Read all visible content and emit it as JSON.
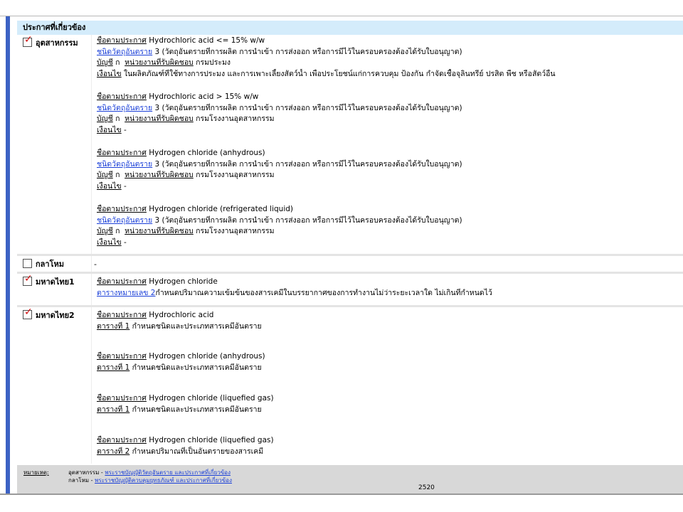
{
  "section": {
    "title": "ประกาศที่เกี่ยวข้อง"
  },
  "categories": [
    {
      "label": "อุตสาหกรรม",
      "checked": true,
      "entries": [
        {
          "name_label": "ชื่อตามประกาศ",
          "name": "Hydrochloric acid <= 15% w/w",
          "type_label": "ชนิดวัตถุอันตราย",
          "type_text": "3 (วัตถุอันตรายที่การผลิต การนำเข้า การส่งออก หรือการมีไว้ในครอบครองต้องได้รับใบอนุญาต)",
          "list_label": "บัญชี",
          "list_value": "ก",
          "agency_label": "หน่วยงานที่รับผิดชอบ",
          "agency_value": "กรมประมง",
          "cond_label": "เงื่อนไข",
          "cond_text": "ในผลิตภัณฑ์ที่ใช้ทางการประมง และการเพาะเลี้ยงสัตว์น้ำ เพื่อประโยชน์แก่การควบคุม ป้องกัน กำจัดเชื้อจุลินทรีย์ ปรสิต พืช หรือสัตว์อื่น"
        },
        {
          "name_label": "ชื่อตามประกาศ",
          "name": "Hydrochloric acid > 15% w/w",
          "type_label": "ชนิดวัตถุอันตราย",
          "type_text": "3 (วัตถุอันตรายที่การผลิต การนำเข้า การส่งออก หรือการมีไว้ในครอบครองต้องได้รับใบอนุญาต)",
          "list_label": "บัญชี",
          "list_value": "ก",
          "agency_label": "หน่วยงานที่รับผิดชอบ",
          "agency_value": "กรมโรงงานอุตสาหกรรม",
          "cond_label": "เงื่อนไข",
          "cond_text": "-"
        },
        {
          "name_label": "ชื่อตามประกาศ",
          "name": "Hydrogen chloride (anhydrous)",
          "type_label": "ชนิดวัตถุอันตราย",
          "type_text": "3 (วัตถุอันตรายที่การผลิต การนำเข้า การส่งออก หรือการมีไว้ในครอบครองต้องได้รับใบอนุญาต)",
          "list_label": "บัญชี",
          "list_value": "ก",
          "agency_label": "หน่วยงานที่รับผิดชอบ",
          "agency_value": "กรมโรงงานอุตสาหกรรม",
          "cond_label": "เงื่อนไข",
          "cond_text": "-"
        },
        {
          "name_label": "ชื่อตามประกาศ",
          "name": "Hydrogen chloride (refrigerated liquid)",
          "type_label": "ชนิดวัตถุอันตราย",
          "type_text": "3 (วัตถุอันตรายที่การผลิต การนำเข้า การส่งออก หรือการมีไว้ในครอบครองต้องได้รับใบอนุญาต)",
          "list_label": "บัญชี",
          "list_value": "ก",
          "agency_label": "หน่วยงานที่รับผิดชอบ",
          "agency_value": "กรมโรงงานอุตสาหกรรม",
          "cond_label": "เงื่อนไข",
          "cond_text": "-"
        }
      ]
    },
    {
      "label": "กลาโหม",
      "checked": false,
      "empty_text": "-"
    },
    {
      "label": "มหาดไทย1",
      "checked": true,
      "entries": [
        {
          "name_label": "ชื่อตามประกาศ",
          "name": "Hydrogen chloride",
          "table_label": "ตารางหมายเลข 2",
          "table_text": "กำหนดปริมาณความเข้มข้นของสารเคมีในบรรยากาศของการทำงานไม่ว่าระยะเวลาใด ไม่เกินที่กำหนดไว้"
        }
      ]
    },
    {
      "label": "มหาดไทย2",
      "checked": true,
      "entries": [
        {
          "name_label": "ชื่อตามประกาศ",
          "name": "Hydrochloric acid",
          "table_label": "ตารางที่ 1",
          "table_text": "กำหนดชนิดและประเภทสารเคมีอันตราย"
        },
        {
          "name_label": "ชื่อตามประกาศ",
          "name": "Hydrogen chloride (anhydrous)",
          "table_label": "ตารางที่ 1",
          "table_text": "กำหนดชนิดและประเภทสารเคมีอันตราย"
        },
        {
          "name_label": "ชื่อตามประกาศ",
          "name": "Hydrogen chloride (liquefied gas)",
          "table_label": "ตารางที่ 1",
          "table_text": "กำหนดชนิดและประเภทสารเคมีอันตราย"
        },
        {
          "name_label": "ชื่อตามประกาศ",
          "name": "Hydrogen chloride (liquefied gas)",
          "table_label": "ตารางที่ 2",
          "table_text": "กำหนดปริมาณที่เป็นอันตรายของสารเคมี"
        }
      ]
    }
  ],
  "notes": {
    "heading": "หมายเหตุ:",
    "line1_prefix": "อุตสาหกรรม -",
    "line1_link": "พระราชบัญญัติวัตถุอันตราย และประกาศที่เกี่ยวข้อง",
    "line2_prefix": "กลาโหม -",
    "line2_link": "พระราชบัญญัติควบคุมยุทธภัณฑ์ และประกาศที่เกี่ยวข้อง",
    "line3_partial": "2520"
  },
  "colors": {
    "accent_bar": "#3c62c4",
    "header_bg": "#d4ecfb",
    "link": "#1a3fd8",
    "check": "#d01010"
  }
}
